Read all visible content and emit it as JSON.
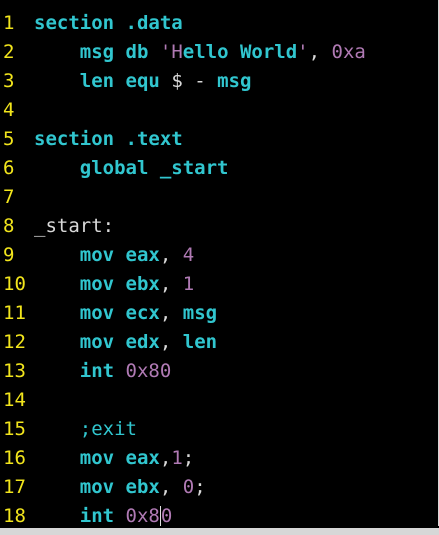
{
  "editor": {
    "lines": [
      {
        "num": "1",
        "parts": [
          {
            "c": "kw",
            "t": "section"
          },
          {
            "c": "txt",
            "t": " "
          },
          {
            "c": "kw",
            "t": ".data"
          }
        ]
      },
      {
        "num": "2",
        "parts": [
          {
            "c": "txt",
            "t": "    "
          },
          {
            "c": "id",
            "t": "msg"
          },
          {
            "c": "txt",
            "t": " "
          },
          {
            "c": "kw",
            "t": "db"
          },
          {
            "c": "txt",
            "t": " "
          },
          {
            "c": "str",
            "t": "'H"
          },
          {
            "c": "id",
            "t": "ello World"
          },
          {
            "c": "str",
            "t": "'"
          },
          {
            "c": "txt",
            "t": ", "
          },
          {
            "c": "num",
            "t": "0xa"
          }
        ]
      },
      {
        "num": "3",
        "parts": [
          {
            "c": "txt",
            "t": "    "
          },
          {
            "c": "id",
            "t": "len"
          },
          {
            "c": "txt",
            "t": " "
          },
          {
            "c": "kw",
            "t": "equ"
          },
          {
            "c": "txt",
            "t": " $ - "
          },
          {
            "c": "id",
            "t": "msg"
          }
        ]
      },
      {
        "num": "4",
        "parts": []
      },
      {
        "num": "5",
        "parts": [
          {
            "c": "kw",
            "t": "section"
          },
          {
            "c": "txt",
            "t": " "
          },
          {
            "c": "kw",
            "t": ".text"
          }
        ]
      },
      {
        "num": "6",
        "parts": [
          {
            "c": "txt",
            "t": "    "
          },
          {
            "c": "kw",
            "t": "global"
          },
          {
            "c": "txt",
            "t": " "
          },
          {
            "c": "id",
            "t": "_start"
          }
        ]
      },
      {
        "num": "7",
        "parts": []
      },
      {
        "num": "8",
        "parts": [
          {
            "c": "txt",
            "t": "_start:"
          }
        ]
      },
      {
        "num": "9",
        "parts": [
          {
            "c": "txt",
            "t": "    "
          },
          {
            "c": "kw",
            "t": "mov"
          },
          {
            "c": "txt",
            "t": " "
          },
          {
            "c": "id",
            "t": "eax"
          },
          {
            "c": "txt",
            "t": ", "
          },
          {
            "c": "num",
            "t": "4"
          }
        ]
      },
      {
        "num": "10",
        "parts": [
          {
            "c": "txt",
            "t": "    "
          },
          {
            "c": "kw",
            "t": "mov"
          },
          {
            "c": "txt",
            "t": " "
          },
          {
            "c": "id",
            "t": "ebx"
          },
          {
            "c": "txt",
            "t": ", "
          },
          {
            "c": "num",
            "t": "1"
          }
        ]
      },
      {
        "num": "11",
        "parts": [
          {
            "c": "txt",
            "t": "    "
          },
          {
            "c": "kw",
            "t": "mov"
          },
          {
            "c": "txt",
            "t": " "
          },
          {
            "c": "id",
            "t": "ecx"
          },
          {
            "c": "txt",
            "t": ", "
          },
          {
            "c": "id",
            "t": "msg"
          }
        ]
      },
      {
        "num": "12",
        "parts": [
          {
            "c": "txt",
            "t": "    "
          },
          {
            "c": "kw",
            "t": "mov"
          },
          {
            "c": "txt",
            "t": " "
          },
          {
            "c": "id",
            "t": "edx"
          },
          {
            "c": "txt",
            "t": ", "
          },
          {
            "c": "id",
            "t": "len"
          }
        ]
      },
      {
        "num": "13",
        "parts": [
          {
            "c": "txt",
            "t": "    "
          },
          {
            "c": "kw",
            "t": "int"
          },
          {
            "c": "txt",
            "t": " "
          },
          {
            "c": "num",
            "t": "0x80"
          }
        ]
      },
      {
        "num": "14",
        "parts": []
      },
      {
        "num": "15",
        "parts": [
          {
            "c": "txt",
            "t": "    "
          },
          {
            "c": "cm",
            "t": ";exit"
          }
        ]
      },
      {
        "num": "16",
        "parts": [
          {
            "c": "txt",
            "t": "    "
          },
          {
            "c": "kw",
            "t": "mov"
          },
          {
            "c": "txt",
            "t": " "
          },
          {
            "c": "id",
            "t": "eax"
          },
          {
            "c": "txt",
            "t": ","
          },
          {
            "c": "num",
            "t": "1"
          },
          {
            "c": "txt",
            "t": ";"
          }
        ]
      },
      {
        "num": "17",
        "parts": [
          {
            "c": "txt",
            "t": "    "
          },
          {
            "c": "kw",
            "t": "mov"
          },
          {
            "c": "txt",
            "t": " "
          },
          {
            "c": "id",
            "t": "ebx"
          },
          {
            "c": "txt",
            "t": ", "
          },
          {
            "c": "num",
            "t": "0"
          },
          {
            "c": "txt",
            "t": ";"
          }
        ]
      },
      {
        "num": "18",
        "parts": [
          {
            "c": "txt",
            "t": "    "
          },
          {
            "c": "kw",
            "t": "int"
          },
          {
            "c": "txt",
            "t": " "
          },
          {
            "c": "num",
            "t": "0x8"
          },
          {
            "c": "caret",
            "t": ""
          },
          {
            "c": "num",
            "t": "0"
          }
        ]
      }
    ],
    "colors": {
      "background": "#000000",
      "line_number": "#f2e51c",
      "keyword": "#31c6cf",
      "number_string": "#b07ab4",
      "plain_text": "#d9d9d9"
    }
  }
}
